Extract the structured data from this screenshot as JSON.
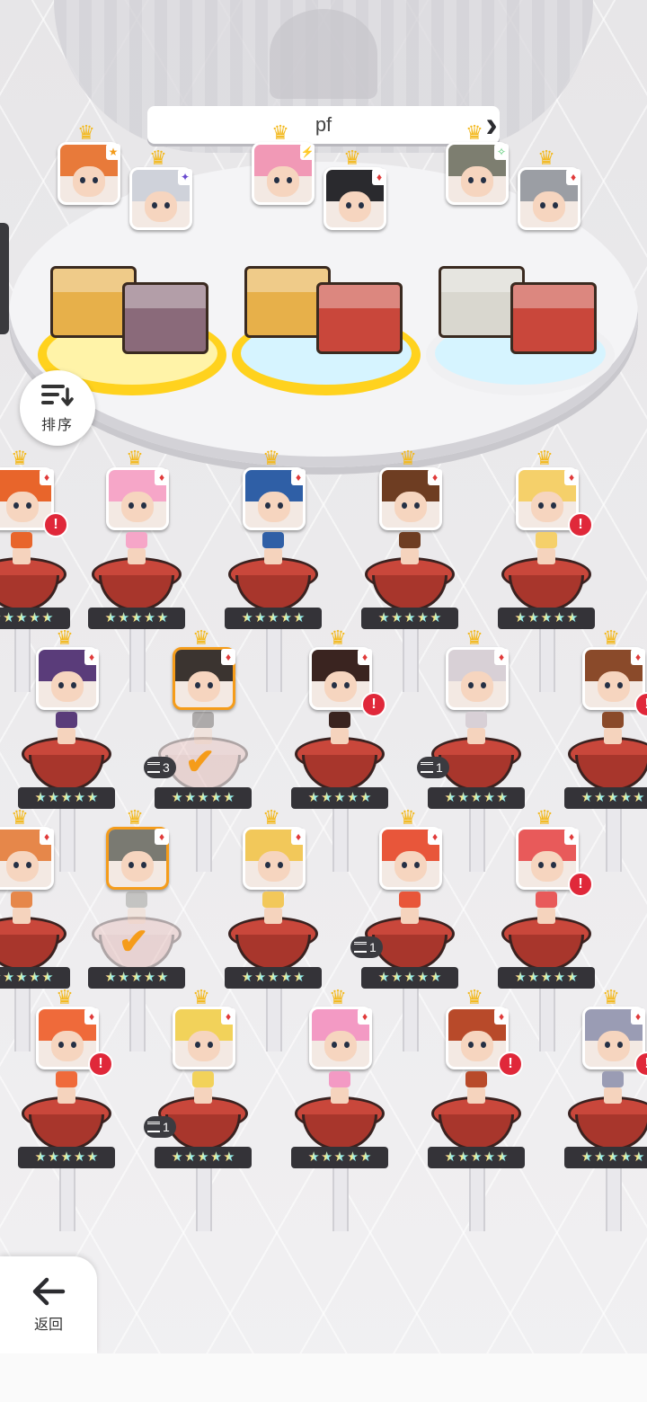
{
  "header": {
    "title": "pf"
  },
  "sort_button": {
    "label": "排序"
  },
  "back_button": {
    "label": "返回"
  },
  "colors": {
    "accent": "#f59c1a",
    "alert": "#e0283a",
    "pedestal": "#c9473b",
    "crown": "#f3b81b"
  },
  "team": [
    {
      "pad_color": "#ffd21e",
      "pad_inner": "#fff3a8",
      "members": [
        {
          "suit": "★",
          "suit_color": "#f39b1a",
          "hair": "#e87a3a",
          "block": "#e7b04a"
        },
        {
          "suit": "✦",
          "suit_color": "#6a4bd0",
          "hair": "#cfd2da",
          "block": "#8a6a7a"
        }
      ]
    },
    {
      "pad_color": "#ffd21e",
      "pad_inner": "#d6f4ff",
      "members": [
        {
          "suit": "⚡",
          "suit_color": "#f3b81b",
          "hair": "#f199b6",
          "block": "#e7b04a"
        },
        {
          "suit": "♦",
          "suit_color": "#e03a3a",
          "hair": "#2a2a2e",
          "block": "#c9473b"
        }
      ]
    },
    {
      "pad_color": "#f0f0f2",
      "pad_inner": "#d6f4ff",
      "members": [
        {
          "suit": "✧",
          "suit_color": "#4cc66a",
          "hair": "#7d7e70",
          "block": "#d9d7cf"
        },
        {
          "suit": "♦",
          "suit_color": "#e03a3a",
          "hair": "#9b9ea4",
          "block": "#c9473b"
        }
      ]
    }
  ],
  "roster": [
    {
      "hair": "#e8652b",
      "alert": "!"
    },
    {
      "hair": "#f6a6c8"
    },
    {
      "hair": "#2f5fa6"
    },
    {
      "hair": "#6e3d22"
    },
    {
      "hair": "#f5d06a",
      "alert": "!"
    },
    {
      "hair": "#5a3c7a"
    },
    {
      "hair": "#3b3430",
      "selected": true,
      "faded": true,
      "stack": "3",
      "check": "✔"
    },
    {
      "hair": "#3a2420",
      "alert": "!"
    },
    {
      "hair": "#d8d0d6",
      "stack": "1"
    },
    {
      "hair": "#8a4a2a",
      "alert": "!"
    },
    {
      "hair": "#e6874a"
    },
    {
      "hair": "#7a7a72",
      "selected": true,
      "faded": true,
      "check": "✔"
    },
    {
      "hair": "#f2c85a"
    },
    {
      "hair": "#e8563a",
      "stack": "1"
    },
    {
      "hair": "#e85a5a",
      "alert": "!"
    },
    {
      "hair": "#ef6a3a",
      "alert": "!"
    },
    {
      "hair": "#f2d25a",
      "stack": "1"
    },
    {
      "hair": "#f39ac4"
    },
    {
      "hair": "#b84a2a",
      "alert": "!"
    },
    {
      "hair": "#9a9cb4",
      "alert": "!"
    }
  ],
  "stars_per_unit": "★★★★★"
}
